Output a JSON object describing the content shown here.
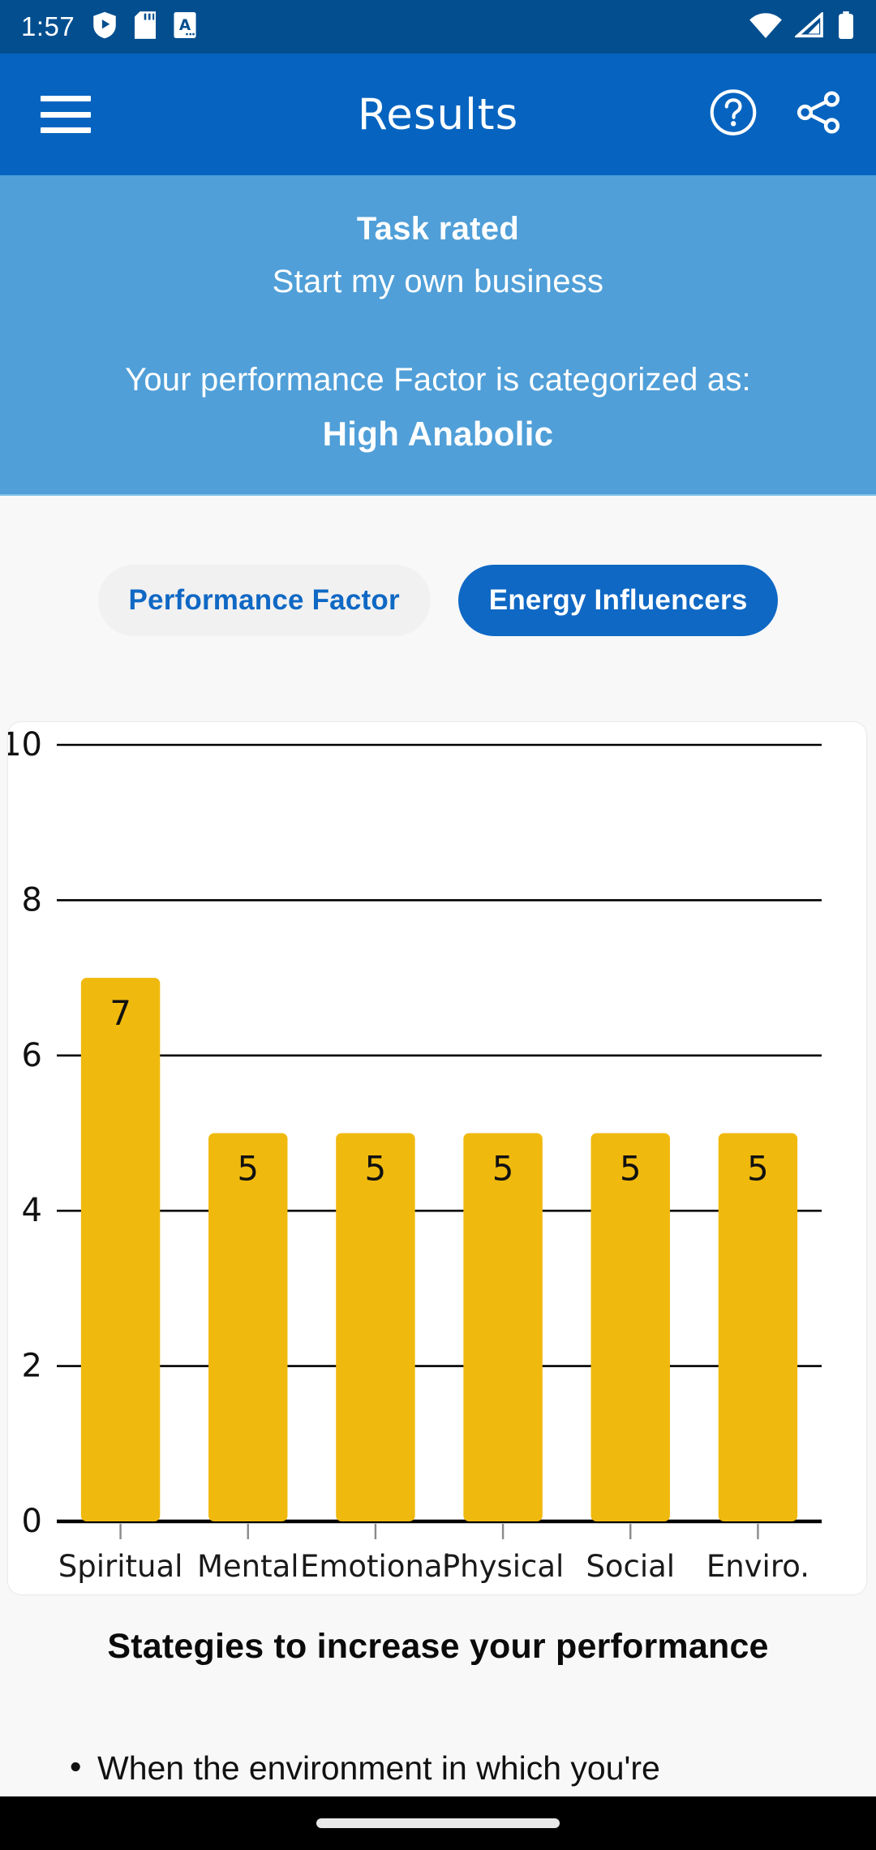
{
  "status_bar": {
    "time": "1:57",
    "left_icons": [
      "shield-play-icon",
      "sd-card-icon",
      "text-a-icon"
    ],
    "right_icons": [
      "wifi-icon",
      "cellular-signal-icon",
      "battery-icon"
    ],
    "background_color": "#024E8F"
  },
  "app_bar": {
    "title": "Results",
    "menu_icon": "hamburger-menu-icon",
    "help_icon": "help-circle-icon",
    "share_icon": "share-icon",
    "background_color": "#0664C0"
  },
  "info_panel": {
    "task_rated_label": "Task rated",
    "task_name": "Start my own business",
    "category_intro": "Your performance Factor is categorized as:",
    "category_value": "High Anabolic",
    "background_color": "#509FD8"
  },
  "tabs": [
    {
      "label": "Performance Factor",
      "active": false
    },
    {
      "label": "Energy Influencers",
      "active": true
    }
  ],
  "chart_data": {
    "type": "bar",
    "title": "",
    "xlabel": "",
    "ylabel": "",
    "categories": [
      "Spiritual",
      "Mental",
      "Emotional",
      "Physical",
      "Social",
      "Enviro."
    ],
    "values": [
      7,
      5,
      5,
      5,
      5,
      5
    ],
    "data_labels": [
      "7",
      "5",
      "5",
      "5",
      "5",
      "5"
    ],
    "ylim": [
      0,
      10
    ],
    "yticks": [
      0,
      2,
      4,
      6,
      8,
      10
    ],
    "ytick_labels": [
      "0",
      "2",
      "4",
      "6",
      "8",
      "10"
    ],
    "bar_color": "#F0B90D",
    "grid": true,
    "gridline_color": "#000000",
    "legend": "none"
  },
  "strategies": {
    "title": "Stategies to increase your performance",
    "items": [
      "When the environment in which you're"
    ]
  },
  "nav_bar": {
    "gesture_pill": "gesture-pill"
  }
}
